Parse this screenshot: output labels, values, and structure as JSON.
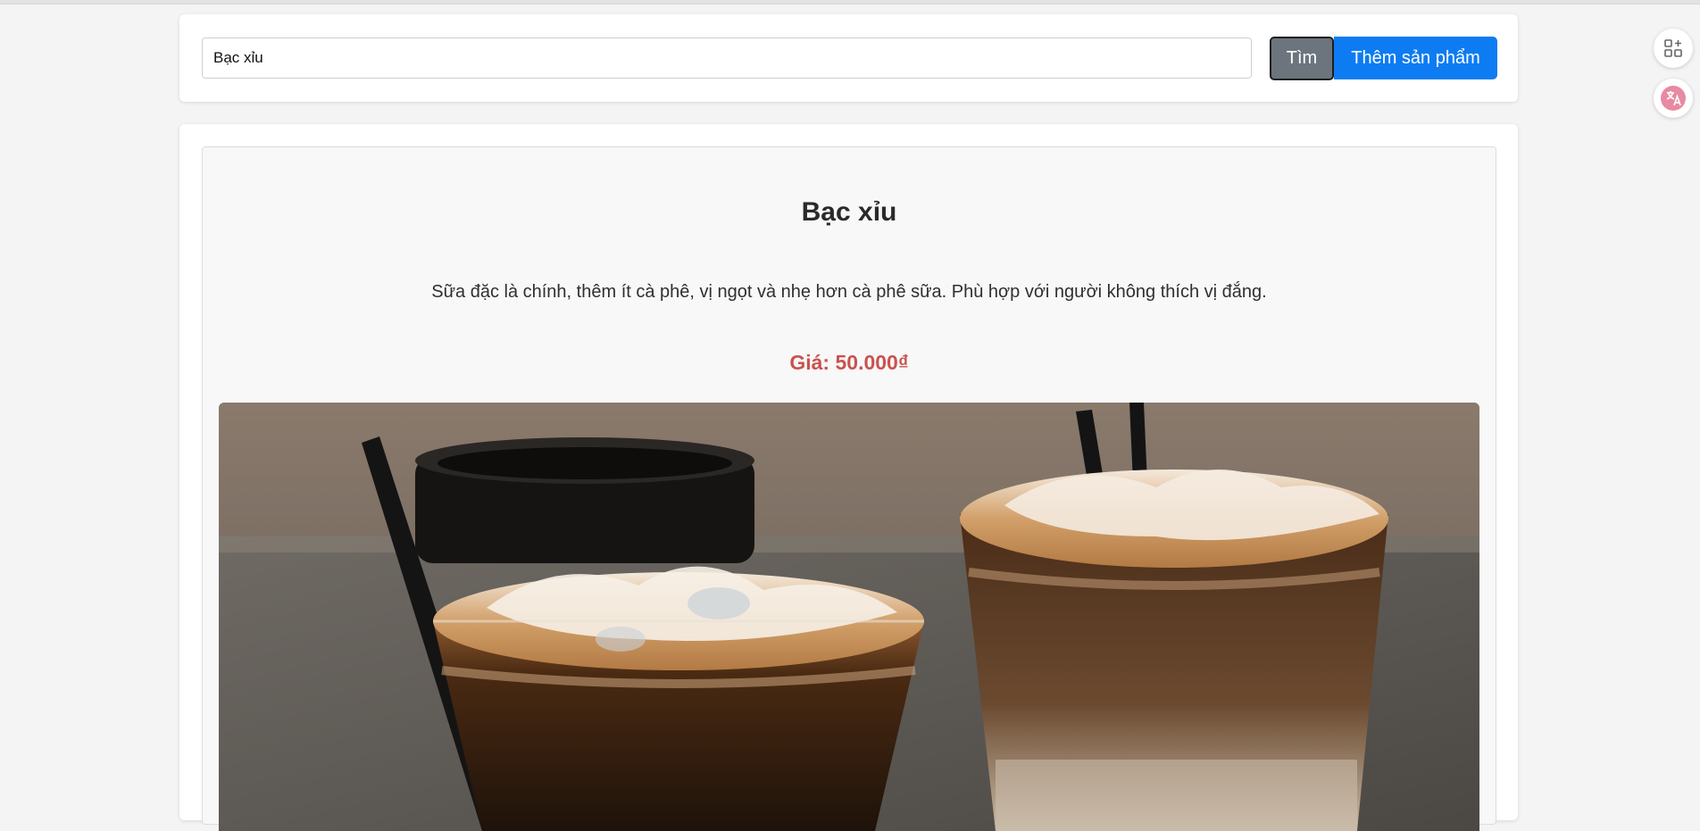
{
  "search": {
    "value": "Bạc xỉu",
    "find_label": "Tìm",
    "add_label": "Thêm sản phẩm"
  },
  "product": {
    "name": "Bạc xỉu",
    "description": "Sữa đặc là chính, thêm ít cà phê, vị ngọt và nhẹ hơn cà phê sữa. Phù hợp với người không thích vị đắng.",
    "price_text": "Giá: 50.000₫"
  },
  "side_tools": {
    "apps_icon": "apps-add-icon",
    "translate_icon": "translate-icon"
  },
  "colors": {
    "accent": "#0d7cf2",
    "secondary_button": "#6c757d",
    "price": "#c9534f"
  }
}
